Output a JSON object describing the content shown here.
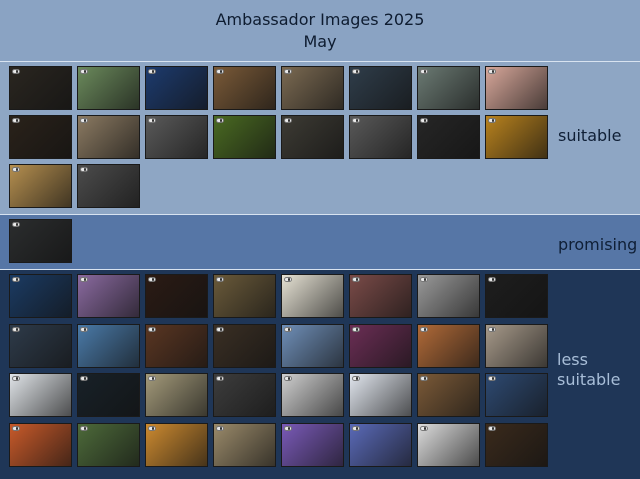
{
  "header": {
    "title": "Ambassador Images 2025",
    "subtitle": "May"
  },
  "sections": [
    {
      "id": "suitable",
      "label": "suitable",
      "count": 18,
      "thumbs": [
        "#2a2620",
        "#6b8a5c",
        "#1d3b6e",
        "#7a5a38",
        "#7b6a52",
        "#2f3d4a",
        "#6b7a73",
        "#d7a79a",
        "#2a221a",
        "#8b7a62",
        "#5a5a5a",
        "#4a6a22",
        "#3d3b34",
        "#595959",
        "#262626",
        "#b8821e",
        "#b58f4f",
        "#4c4c4c"
      ]
    },
    {
      "id": "promising",
      "label": "promising",
      "count": 1,
      "thumbs": [
        "#2b2d2e"
      ]
    },
    {
      "id": "less",
      "label": "less\nsuitable",
      "count": 32,
      "thumbs": [
        "#1b3b63",
        "#8a6aa0",
        "#2b1b14",
        "#6a5a3a",
        "#e6e2d4",
        "#7a4b48",
        "#9a9a9a",
        "#1e1e1e",
        "#2e3b4a",
        "#4a7aa8",
        "#5a3622",
        "#3a2f24",
        "#6f8fb8",
        "#6b2e55",
        "#b06a38",
        "#a79a8a",
        "#e0e4e8",
        "#182128",
        "#a39a7a",
        "#3d3d3d",
        "#cfcfcf",
        "#e1e6ee",
        "#7b5a38",
        "#2e4a72",
        "#c85a2a",
        "#4d6a3a",
        "#cc8a30",
        "#9a8a6a",
        "#7a5ab8",
        "#5a6ab8",
        "#dcdcdc",
        "#3a2a1c"
      ]
    }
  ]
}
